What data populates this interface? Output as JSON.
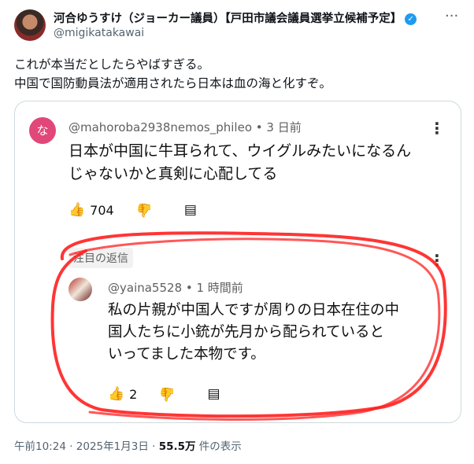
{
  "author": {
    "name": "河合ゆうすけ（ジョーカー議員）【戸田市議会議員選挙立候補予定】",
    "handle": "@migikatakawai",
    "verified_icon": "verified-badge-icon",
    "more": "···"
  },
  "tweet": {
    "line1": "これが本当だとしたらやばすぎる。",
    "line2": "中国で国防動員法が適用されたら日本は血の海と化すぞ。"
  },
  "comment": {
    "avatar_letter": "な",
    "avatar_color": "#e2477a",
    "meta": "@mahoroba2938nemos_phileo • 3 日前",
    "line1": "日本が中国に牛耳られて、ウイグルみたいになるん",
    "line2": "じゃないかと真剣に心配してる",
    "likes": "704",
    "more": "⋮"
  },
  "reply": {
    "featured_label": "注目の返信",
    "meta": "@yaina5528 • 1 時間前",
    "line1": "私の片親が中国人ですが周りの日本在住の中",
    "line2": "国人たちに小銃が先月から配られていると",
    "line3": "いってました本物です。",
    "likes": "2",
    "more": "⋮"
  },
  "footer": {
    "time": "午前10:24 · 2025年1月3日 · ",
    "views": "55.5万",
    "views_label": " 件の表示"
  },
  "colors": {
    "accent": "#1d9bf0",
    "scribble": "#ff1f1f"
  }
}
